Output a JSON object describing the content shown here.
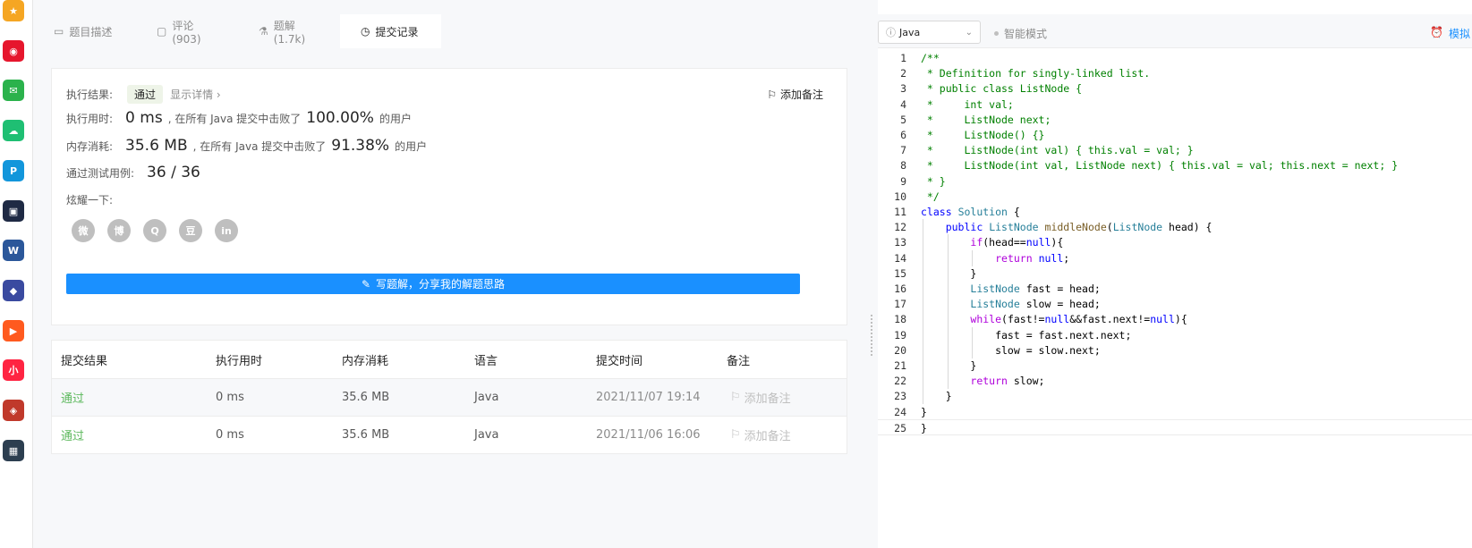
{
  "tabs": [
    {
      "label": "题目描述",
      "icon": "document-icon"
    },
    {
      "label": "评论 (903)",
      "icon": "comment-icon"
    },
    {
      "label": "题解 (1.7k)",
      "icon": "flask-icon"
    },
    {
      "label": "提交记录",
      "icon": "clock-icon"
    }
  ],
  "result": {
    "status_label": "执行结果:",
    "status_value": "通过",
    "detail_link": "显示详情 ›",
    "note_button": "添加备注",
    "time_label": "执行用时:",
    "time_value": "0 ms",
    "time_text": ", 在所有 Java 提交中击败了",
    "time_percent": "100.00%",
    "time_suffix": "的用户",
    "mem_label": "内存消耗:",
    "mem_value": "35.6 MB",
    "mem_text": ", 在所有 Java 提交中击败了",
    "mem_percent": "91.38%",
    "mem_suffix": "的用户",
    "tests_label": "通过测试用例:",
    "tests_value": "36 / 36",
    "share_label": "炫耀一下:",
    "share_icons": [
      "wechat-icon",
      "weibo-icon",
      "qq-icon",
      "douban-icon",
      "linkedin-icon"
    ],
    "share_glyphs": [
      "微",
      "博",
      "Q",
      "豆",
      "in"
    ],
    "write_button": "写题解，分享我的解题思路"
  },
  "table": {
    "headers": [
      "提交结果",
      "执行用时",
      "内存消耗",
      "语言",
      "提交时间",
      "备注"
    ],
    "rows": [
      {
        "result": "通过",
        "time": "0 ms",
        "memory": "35.6 MB",
        "lang": "Java",
        "submitted": "2021/11/07 19:14",
        "note": "添加备注"
      },
      {
        "result": "通过",
        "time": "0 ms",
        "memory": "35.6 MB",
        "lang": "Java",
        "submitted": "2021/11/06 16:06",
        "note": "添加备注"
      }
    ]
  },
  "editor": {
    "language": "Java",
    "smart_mode": "智能模式",
    "simulate": "模拟"
  },
  "code_lines": [
    "/**",
    " * Definition for singly-linked list.",
    " * public class ListNode {",
    " *     int val;",
    " *     ListNode next;",
    " *     ListNode() {}",
    " *     ListNode(int val) { this.val = val; }",
    " *     ListNode(int val, ListNode next) { this.val = val; this.next = next; }",
    " * }",
    " */",
    "class Solution {",
    "    public ListNode middleNode(ListNode head) {",
    "        if(head==null){",
    "            return null;",
    "        }",
    "        ListNode fast = head;",
    "        ListNode slow = head;",
    "        while(fast!=null&&fast.next!=null){",
    "            fast = fast.next.next;",
    "            slow = slow.next;",
    "        }",
    "        return slow;",
    "    }",
    "}"
  ],
  "dock_apps": [
    {
      "icon": "star-icon",
      "color": "#f5a623"
    },
    {
      "icon": "weibo-app-icon",
      "color": "#e6162d"
    },
    {
      "icon": "mail-icon",
      "color": "#2bb24c"
    },
    {
      "icon": "cloud-icon",
      "color": "#1fbf73"
    },
    {
      "icon": "pdf-icon",
      "color": "#1296db"
    },
    {
      "icon": "app-icon",
      "color": "#1f2a44"
    },
    {
      "icon": "word-icon",
      "color": "#2b579a"
    },
    {
      "icon": "game-icon",
      "color": "#3a4aa0"
    },
    {
      "icon": "video-icon",
      "color": "#ff5a1f"
    },
    {
      "icon": "redbook-icon",
      "color": "#ff2442"
    },
    {
      "icon": "game2-icon",
      "color": "#c0392b"
    },
    {
      "icon": "game3-icon",
      "color": "#2c3e50"
    }
  ]
}
